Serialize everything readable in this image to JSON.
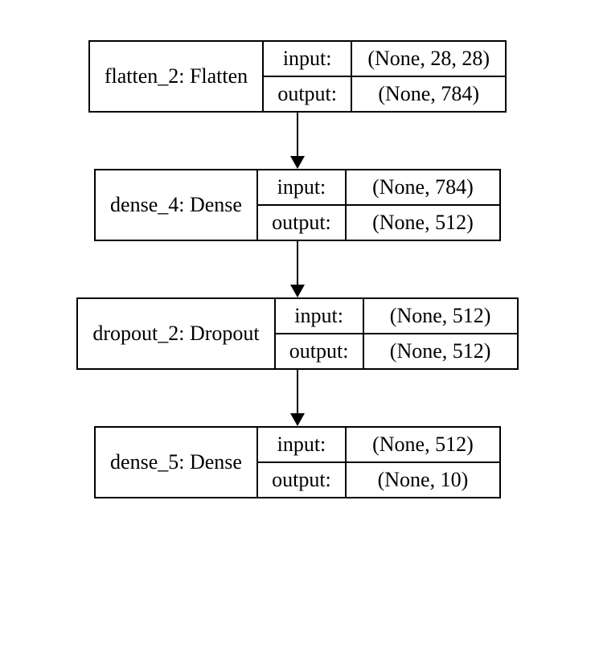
{
  "diagram": {
    "nodes": [
      {
        "name": "flatten_2: Flatten",
        "input_label": "input:",
        "output_label": "output:",
        "input_shape": "(None, 28, 28)",
        "output_shape": "(None, 784)"
      },
      {
        "name": "dense_4: Dense",
        "input_label": "input:",
        "output_label": "output:",
        "input_shape": "(None, 784)",
        "output_shape": "(None, 512)"
      },
      {
        "name": "dropout_2: Dropout",
        "input_label": "input:",
        "output_label": "output:",
        "input_shape": "(None, 512)",
        "output_shape": "(None, 512)"
      },
      {
        "name": "dense_5: Dense",
        "input_label": "input:",
        "output_label": "output:",
        "input_shape": "(None, 512)",
        "output_shape": "(None, 10)"
      }
    ]
  }
}
